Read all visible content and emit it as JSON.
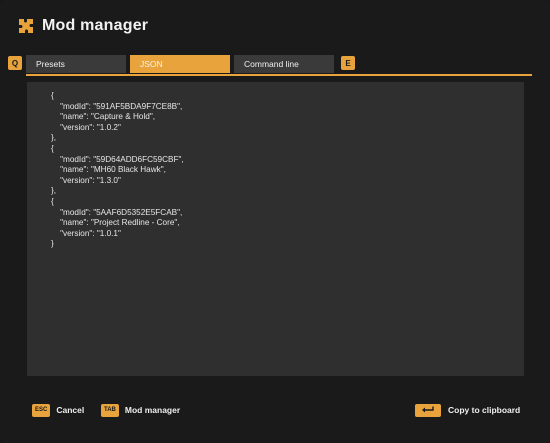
{
  "window": {
    "title": "Mod manager",
    "title_icon": "puzzle-icon",
    "accent_color": "#e8a33d",
    "background_color": "#1a1a1a",
    "panel_color": "#2f2f2f"
  },
  "tabs": {
    "prev_key": "Q",
    "next_key": "E",
    "items": [
      {
        "label": "Presets",
        "active": false
      },
      {
        "label": "JSON",
        "active": true
      },
      {
        "label": "Command line",
        "active": false
      }
    ]
  },
  "json_content": "{\n    \"modId\": \"591AF5BDA9F7CE8B\",\n    \"name\": \"Capture & Hold\",\n    \"version\": \"1.0.2\"\n},\n{\n    \"modId\": \"59D64ADD6FC59CBF\",\n    \"name\": \"MH60 Black Hawk\",\n    \"version\": \"1.3.0\"\n},\n{\n    \"modId\": \"5AAF6D5352E5FCAB\",\n    \"name\": \"Project Redline - Core\",\n    \"version\": \"1.0.1\"\n}",
  "footer": {
    "cancel": {
      "key": "ESC",
      "label": "Cancel"
    },
    "mod_manager": {
      "key": "TAB",
      "label": "Mod manager"
    },
    "copy": {
      "key_icon": "enter-key-icon",
      "label": "Copy to clipboard"
    }
  }
}
